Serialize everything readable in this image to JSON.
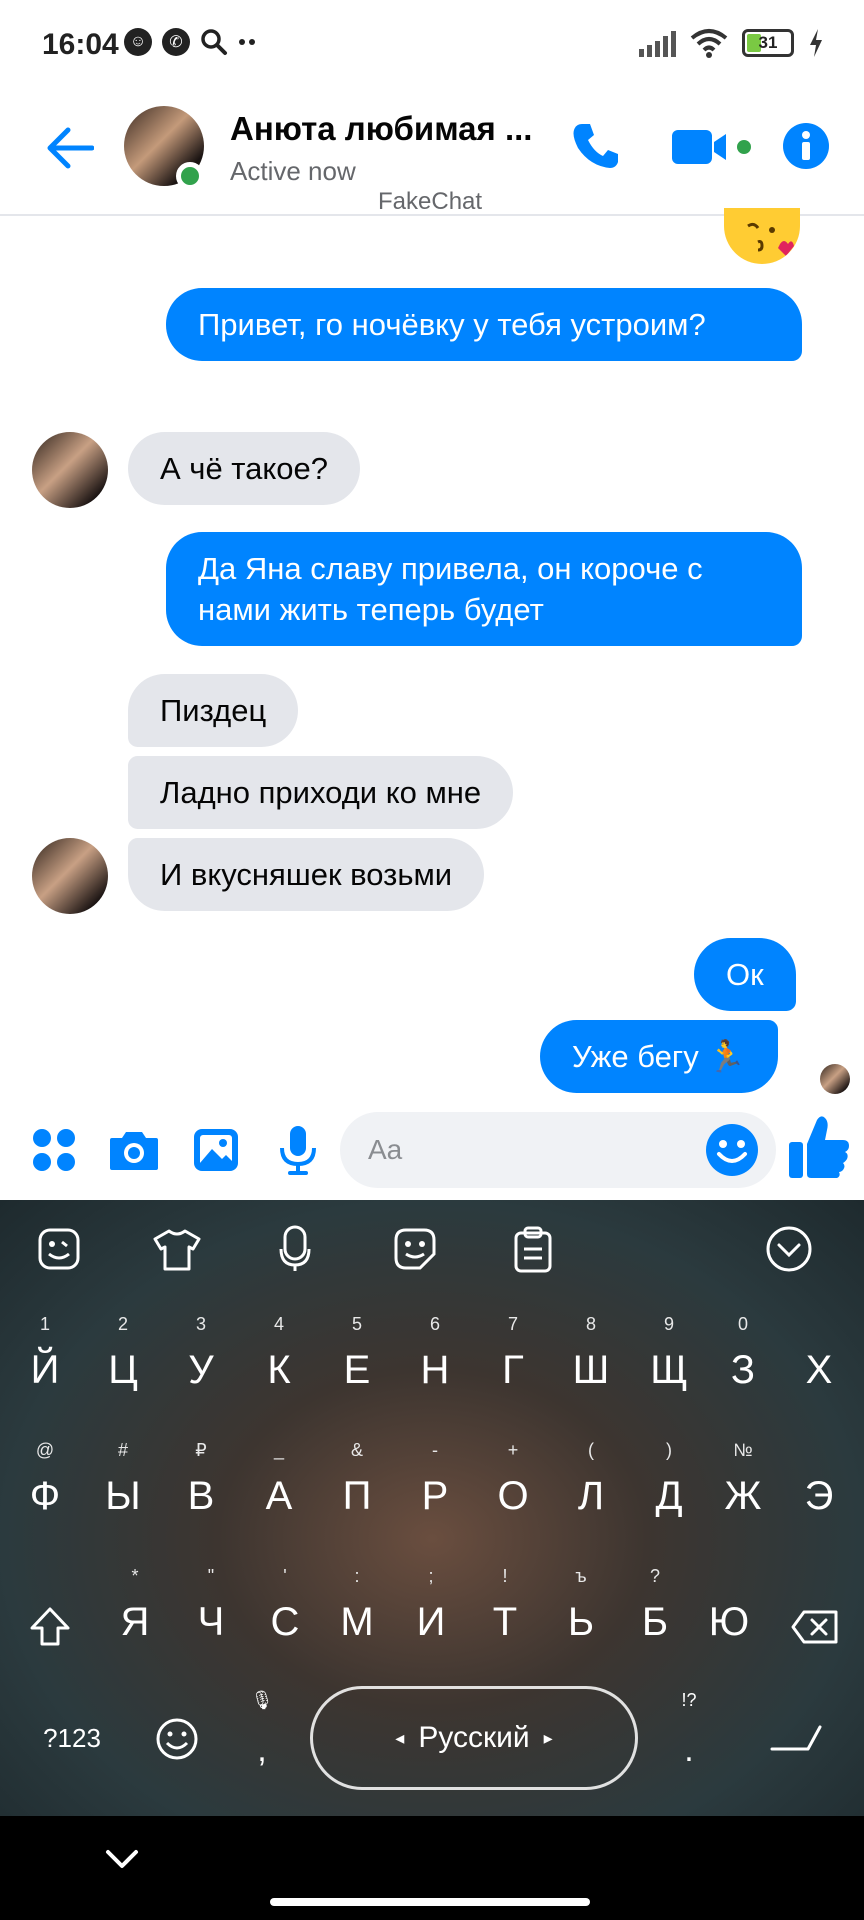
{
  "status_bar": {
    "time": "16:04",
    "battery_level": "31"
  },
  "header": {
    "contact_name": "Анюта любимая ...",
    "status": "Active now",
    "watermark": "FakeChat",
    "accent_color": "#0084ff",
    "online_color": "#31a24c"
  },
  "messages": [
    {
      "direction": "out",
      "text": "Привет, го ночёвку у тебя устроим?"
    },
    {
      "direction": "in",
      "text": "А чё такое?"
    },
    {
      "direction": "out",
      "text": "Да Яна славу привела, он короче с нами жить теперь будет"
    },
    {
      "direction": "in",
      "text": "Пиздец"
    },
    {
      "direction": "in",
      "text": "Ладно приходи ко мне"
    },
    {
      "direction": "in",
      "text": "И вкусняшек возьми"
    },
    {
      "direction": "out",
      "text": "Ок"
    },
    {
      "direction": "out",
      "text": "Уже бегу 🏃"
    }
  ],
  "composer": {
    "placeholder": "Aa",
    "icons": [
      "apps-icon",
      "camera-icon",
      "gallery-icon",
      "microphone-icon",
      "emoji-icon",
      "like-icon"
    ]
  },
  "keyboard": {
    "language": "Русский",
    "symbols_key": "?123",
    "comma": ",",
    "period": ".",
    "period_hint": "!?",
    "comma_hint": "🎙",
    "row1": [
      {
        "main": "Й",
        "hint": "1"
      },
      {
        "main": "Ц",
        "hint": "2"
      },
      {
        "main": "У",
        "hint": "3"
      },
      {
        "main": "К",
        "hint": "4"
      },
      {
        "main": "Е",
        "hint": "5"
      },
      {
        "main": "Н",
        "hint": "6"
      },
      {
        "main": "Г",
        "hint": "7"
      },
      {
        "main": "Ш",
        "hint": "8"
      },
      {
        "main": "Щ",
        "hint": "9"
      },
      {
        "main": "З",
        "hint": "0"
      },
      {
        "main": "Х",
        "hint": ""
      }
    ],
    "row2": [
      {
        "main": "Ф",
        "hint": "@"
      },
      {
        "main": "Ы",
        "hint": "#"
      },
      {
        "main": "В",
        "hint": "₽"
      },
      {
        "main": "А",
        "hint": "_"
      },
      {
        "main": "П",
        "hint": "&"
      },
      {
        "main": "Р",
        "hint": "-"
      },
      {
        "main": "О",
        "hint": "+"
      },
      {
        "main": "Л",
        "hint": "("
      },
      {
        "main": "Д",
        "hint": ")"
      },
      {
        "main": "Ж",
        "hint": "№"
      },
      {
        "main": "Э",
        "hint": ""
      }
    ],
    "row3": [
      {
        "main": "Я",
        "hint": "*"
      },
      {
        "main": "Ч",
        "hint": "\""
      },
      {
        "main": "С",
        "hint": "'"
      },
      {
        "main": "М",
        "hint": ":"
      },
      {
        "main": "И",
        "hint": ";"
      },
      {
        "main": "Т",
        "hint": "!"
      },
      {
        "main": "Ь",
        "hint": "ъ"
      },
      {
        "main": "Б",
        "hint": "?"
      },
      {
        "main": "Ю",
        "hint": ""
      }
    ]
  }
}
